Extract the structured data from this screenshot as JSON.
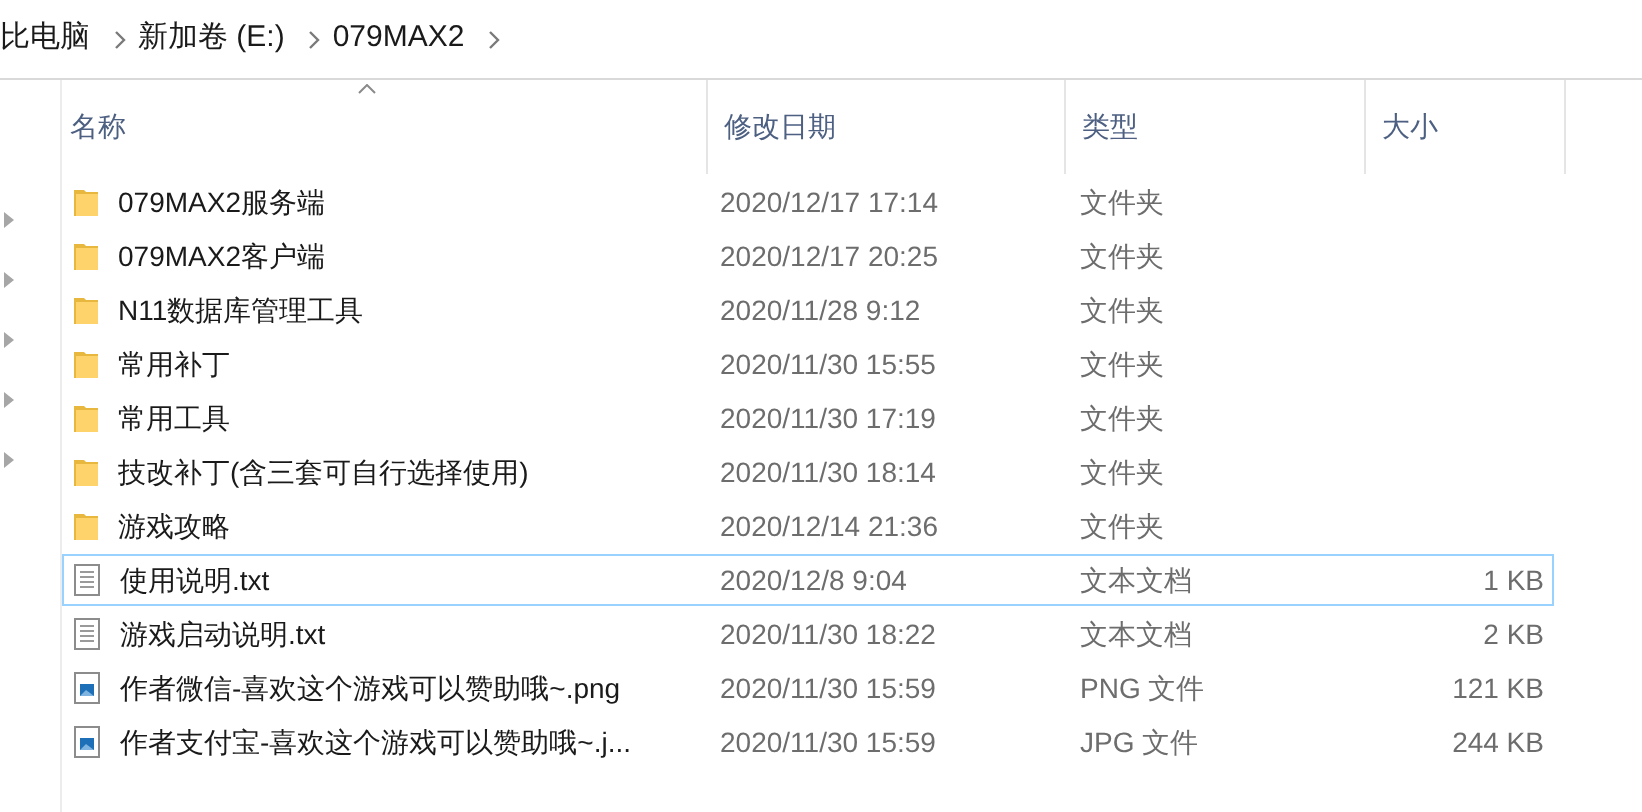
{
  "breadcrumb": [
    "比电脑",
    "新加卷 (E:)",
    "079MAX2"
  ],
  "columns": [
    {
      "label": "名称",
      "sorted": true
    },
    {
      "label": "修改日期",
      "sorted": false
    },
    {
      "label": "类型",
      "sorted": false
    },
    {
      "label": "大小",
      "sorted": false
    }
  ],
  "rows": [
    {
      "kind": "folder",
      "name": "079MAX2服务端",
      "modified": "2020/12/17 17:14",
      "type": "文件夹",
      "focused": false
    },
    {
      "kind": "folder",
      "name": "079MAX2客户端",
      "modified": "2020/12/17 20:25",
      "type": "文件夹",
      "focused": false
    },
    {
      "kind": "folder",
      "name": "N11数据库管理工具",
      "modified": "2020/11/28 9:12",
      "type": "文件夹",
      "focused": false
    },
    {
      "kind": "folder",
      "name": "常用补丁",
      "modified": "2020/11/30 15:55",
      "type": "文件夹",
      "focused": false
    },
    {
      "kind": "folder",
      "name": "常用工具",
      "modified": "2020/11/30 17:19",
      "type": "文件夹",
      "focused": false
    },
    {
      "kind": "folder",
      "name": "技改补丁(含三套可自行选择使用)",
      "modified": "2020/11/30 18:14",
      "type": "文件夹",
      "focused": false
    },
    {
      "kind": "folder",
      "name": "游戏攻略",
      "modified": "2020/12/14 21:36",
      "type": "文件夹",
      "focused": false
    },
    {
      "kind": "text",
      "name": "使用说明.txt",
      "modified": "2020/12/8 9:04",
      "type": "文本文档",
      "size": "1 KB",
      "focused": true
    },
    {
      "kind": "text",
      "name": "游戏启动说明.txt",
      "modified": "2020/11/30 18:22",
      "type": "文本文档",
      "size": "2 KB",
      "focused": false
    },
    {
      "kind": "image",
      "name": "作者微信-喜欢这个游戏可以赞助哦~.png",
      "modified": "2020/11/30 15:59",
      "type": "PNG 文件",
      "size": "121 KB",
      "focused": false
    },
    {
      "kind": "image",
      "name": "作者支付宝-喜欢这个游戏可以赞助哦~.j...",
      "modified": "2020/11/30 15:59",
      "type": "JPG 文件",
      "size": "244 KB",
      "focused": false
    }
  ]
}
